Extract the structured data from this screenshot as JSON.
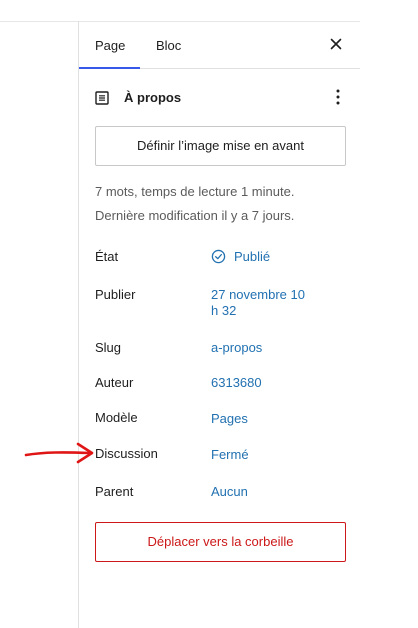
{
  "tabs": {
    "page": "Page",
    "block": "Bloc"
  },
  "document": {
    "title": "À propos"
  },
  "featured_image_button": "Définir l’image mise en avant",
  "meta": {
    "word_count": "7 mots, temps de lecture 1 minute.",
    "last_modified": "Dernière modification il y a 7 jours."
  },
  "rows": {
    "status": {
      "label": "État",
      "value": "Publié"
    },
    "publish": {
      "label": "Publier",
      "value_line1": "27 novembre 10",
      "value_line2": "h 32"
    },
    "slug": {
      "label": "Slug",
      "value": "a-propos"
    },
    "author": {
      "label": "Auteur",
      "value": "6313680"
    },
    "template": {
      "label": "Modèle",
      "value": "Pages"
    },
    "discussion": {
      "label": "Discussion",
      "value": "Fermé"
    },
    "parent": {
      "label": "Parent",
      "value": "Aucun"
    }
  },
  "trash_button": "Déplacer vers la corbeille",
  "colors": {
    "accent": "#3858e9",
    "link": "#2271b1",
    "danger": "#cc1818",
    "annotation": "#e01515"
  },
  "icons": [
    "close-icon",
    "document-icon",
    "more-vertical-icon",
    "published-check-icon",
    "arrow-annotation"
  ]
}
